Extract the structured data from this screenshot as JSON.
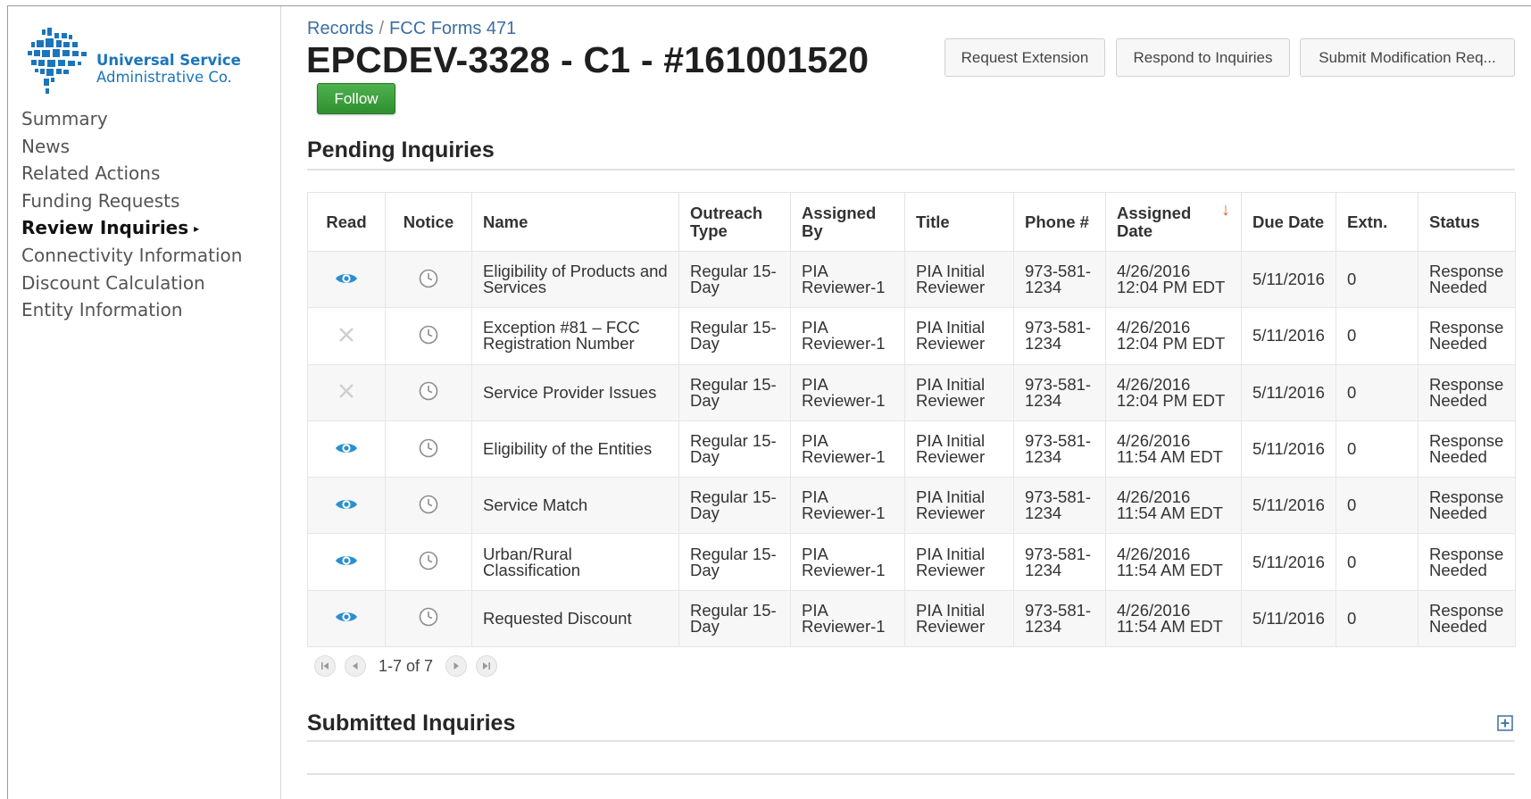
{
  "brand": {
    "name_line1": "Universal Service",
    "name_line2": "Administrative Co.",
    "color": "#1b75bb"
  },
  "nav": {
    "items": [
      {
        "label": "Summary"
      },
      {
        "label": "News"
      },
      {
        "label": "Related Actions"
      },
      {
        "label": "Funding Requests"
      },
      {
        "label": "Review Inquiries",
        "active": true
      },
      {
        "label": "Connectivity Information"
      },
      {
        "label": "Discount Calculation"
      },
      {
        "label": "Entity Information"
      }
    ]
  },
  "breadcrumb": {
    "root": "Records",
    "separator": "/",
    "current": "FCC Forms 471"
  },
  "header": {
    "title": "EPCDEV-3328 - C1 - #161001520",
    "follow_label": "Follow",
    "actions": {
      "request_extension": "Request Extension",
      "respond_to_inquiries": "Respond to Inquiries",
      "submit_modification": "Submit Modification Req..."
    }
  },
  "pending": {
    "title": "Pending Inquiries",
    "columns": {
      "read": "Read",
      "notice": "Notice",
      "name": "Name",
      "outreach_type": "Outreach Type",
      "assigned_by": "Assigned By",
      "title": "Title",
      "phone": "Phone #",
      "assigned_date": "Assigned Date",
      "due_date": "Due Date",
      "extn": "Extn.",
      "status": "Status"
    },
    "rows": [
      {
        "read": "eye",
        "name": "Eligibility of Products and Services",
        "outreach_type": "Regular 15-Day",
        "assigned_by": "PIA Reviewer-1",
        "title": "PIA Initial Reviewer",
        "phone": "973-581-1234",
        "assigned_date": "4/26/2016 12:04 PM EDT",
        "due_date": "5/11/2016",
        "extn": "0",
        "status": "Response Needed"
      },
      {
        "read": "x",
        "name": "Exception #81 – FCC Registration Number",
        "outreach_type": "Regular 15-Day",
        "assigned_by": "PIA Reviewer-1",
        "title": "PIA Initial Reviewer",
        "phone": "973-581-1234",
        "assigned_date": "4/26/2016 12:04 PM EDT",
        "due_date": "5/11/2016",
        "extn": "0",
        "status": "Response Needed"
      },
      {
        "read": "x",
        "name": "Service Provider Issues",
        "outreach_type": "Regular 15-Day",
        "assigned_by": "PIA Reviewer-1",
        "title": "PIA Initial Reviewer",
        "phone": "973-581-1234",
        "assigned_date": "4/26/2016 12:04 PM EDT",
        "due_date": "5/11/2016",
        "extn": "0",
        "status": "Response Needed"
      },
      {
        "read": "eye",
        "name": "Eligibility of the Entities",
        "outreach_type": "Regular 15-Day",
        "assigned_by": "PIA Reviewer-1",
        "title": "PIA Initial Reviewer",
        "phone": "973-581-1234",
        "assigned_date": "4/26/2016 11:54 AM EDT",
        "due_date": "5/11/2016",
        "extn": "0",
        "status": "Response Needed"
      },
      {
        "read": "eye",
        "name": "Service Match",
        "outreach_type": "Regular 15-Day",
        "assigned_by": "PIA Reviewer-1",
        "title": "PIA Initial Reviewer",
        "phone": "973-581-1234",
        "assigned_date": "4/26/2016 11:54 AM EDT",
        "due_date": "5/11/2016",
        "extn": "0",
        "status": "Response Needed"
      },
      {
        "read": "eye",
        "name": "Urban/Rural Classification",
        "outreach_type": "Regular 15-Day",
        "assigned_by": "PIA Reviewer-1",
        "title": "PIA Initial Reviewer",
        "phone": "973-581-1234",
        "assigned_date": "4/26/2016 11:54 AM EDT",
        "due_date": "5/11/2016",
        "extn": "0",
        "status": "Response Needed"
      },
      {
        "read": "eye",
        "name": "Requested Discount",
        "outreach_type": "Regular 15-Day",
        "assigned_by": "PIA Reviewer-1",
        "title": "PIA Initial Reviewer",
        "phone": "973-581-1234",
        "assigned_date": "4/26/2016 11:54 AM EDT",
        "due_date": "5/11/2016",
        "extn": "0",
        "status": "Response Needed"
      }
    ],
    "pager_text": "1-7 of 7"
  },
  "submitted": {
    "title": "Submitted Inquiries"
  },
  "icons": {
    "read_yes": "eye-icon",
    "read_no": "x-icon",
    "notice": "clock-icon",
    "sort": "sort-desc-arrow-icon",
    "expand": "plus-square-icon"
  },
  "colors": {
    "link": "#3a6ea5",
    "follow_green": "#3a9e3a",
    "eye_blue": "#2a8fd0",
    "sort_arrow": "#e0652a"
  }
}
